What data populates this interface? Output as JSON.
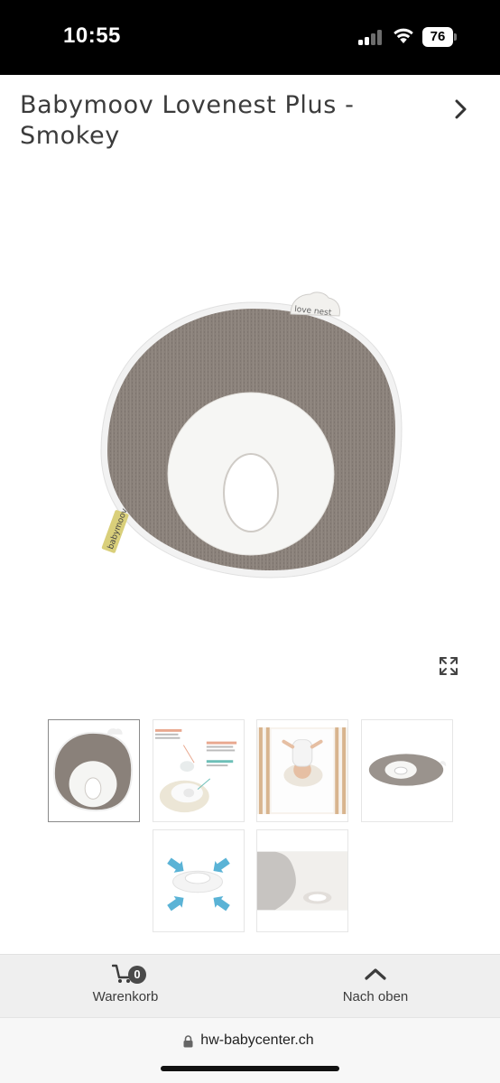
{
  "status_bar": {
    "time": "10:55",
    "battery": "76",
    "icons": [
      "signal-icon",
      "wifi-icon",
      "battery-icon"
    ]
  },
  "product": {
    "title": "Babymoov Lovenest Plus - Smokey",
    "main_image_alt": "Babymoov Lovenest Plus - Smokey",
    "pillow_label": "love nest",
    "brand_tag": "babymoov"
  },
  "thumbnails": [
    {
      "name": "thumb-pillow-top-view",
      "active": true
    },
    {
      "name": "thumb-feature-diagram",
      "active": false
    },
    {
      "name": "thumb-baby-in-crib",
      "active": false
    },
    {
      "name": "thumb-pillow-side-view",
      "active": false
    },
    {
      "name": "thumb-airflow-diagram",
      "active": false
    },
    {
      "name": "thumb-pillow-closeup",
      "active": false
    }
  ],
  "toolbar": {
    "cart_label": "Warenkorb",
    "cart_count": "0",
    "top_label": "Nach oben"
  },
  "browser": {
    "url": "hw-babycenter.ch"
  },
  "colors": {
    "status_bg": "#000000",
    "pillow_grey": "#8a817a",
    "toolbar_bg": "#efefef"
  }
}
